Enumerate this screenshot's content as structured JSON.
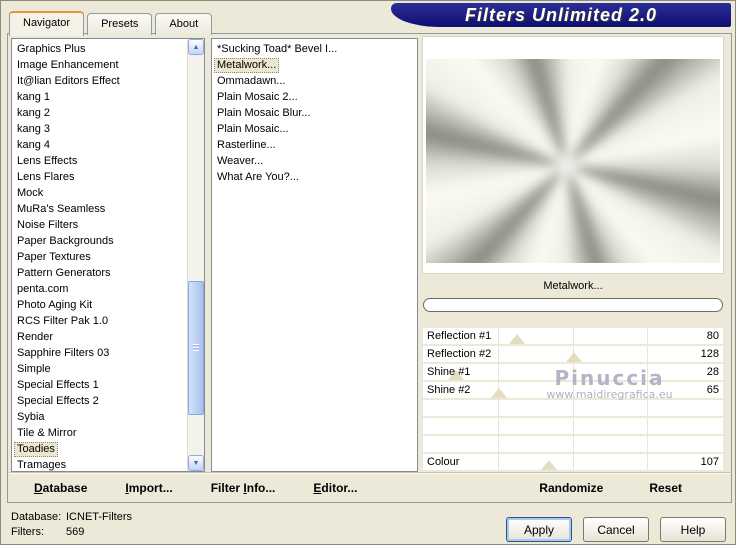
{
  "window": {
    "title": "Filters Unlimited 2.0"
  },
  "tabs": [
    {
      "label": "Navigator",
      "active": true
    },
    {
      "label": "Presets",
      "active": false
    },
    {
      "label": "About",
      "active": false
    }
  ],
  "categories": {
    "selected": "Toadies",
    "items": [
      "Graphics Plus",
      "Image Enhancement",
      "It@lian Editors Effect",
      "kang 1",
      "kang 2",
      "kang 3",
      "kang 4",
      "Lens Effects",
      "Lens Flares",
      "Mock",
      "MuRa's Seamless",
      "Noise Filters",
      "Paper Backgrounds",
      "Paper Textures",
      "Pattern Generators",
      "penta.com",
      "Photo Aging Kit",
      "RCS Filter Pak 1.0",
      "Render",
      "Sapphire Filters 03",
      "Simple",
      "Special Effects 1",
      "Special Effects 2",
      "Sybia",
      "Tile & Mirror",
      "Toadies",
      "Tramages"
    ]
  },
  "filters": {
    "selected": "Metalwork...",
    "items": [
      "*Sucking Toad*  Bevel I...",
      "Metalwork...",
      "Ommadawn...",
      "Plain Mosaic 2...",
      "Plain Mosaic Blur...",
      "Plain Mosaic...",
      "Rasterline...",
      "Weaver...",
      "What Are You?..."
    ]
  },
  "preview": {
    "caption": "Metalwork..."
  },
  "sliders": {
    "max": 255,
    "rows": [
      {
        "label": "Reflection #1",
        "value": 80
      },
      {
        "label": "Reflection #2",
        "value": 128
      },
      {
        "label": "Shine #1",
        "value": 28
      },
      {
        "label": "Shine #2",
        "value": 65
      },
      {
        "label": "",
        "value": null
      },
      {
        "label": "",
        "value": null
      },
      {
        "label": "",
        "value": null
      },
      {
        "label": "Colour",
        "value": 107
      }
    ]
  },
  "watermark": {
    "line1": "Pinuccia",
    "line2": "www.maidiregrafica.eu"
  },
  "menu": [
    {
      "pre": "",
      "key": "D",
      "post": "atabase"
    },
    {
      "pre": "",
      "key": "I",
      "post": "mport..."
    },
    {
      "pre": "Filter ",
      "key": "I",
      "post": "nfo..."
    },
    {
      "pre": "",
      "key": "E",
      "post": "ditor..."
    }
  ],
  "actions": [
    {
      "label": "Randomize"
    },
    {
      "label": "Reset"
    }
  ],
  "status": {
    "rows": [
      {
        "label": "Database:",
        "value": "ICNET-Filters"
      },
      {
        "label": "Filters:",
        "value": "569"
      }
    ]
  },
  "dialog_buttons": [
    {
      "label": "Apply",
      "focused": true
    },
    {
      "label": "Cancel",
      "focused": false
    },
    {
      "label": "Help",
      "focused": false
    }
  ],
  "colors": {
    "dialog_bg": "#ece9d8",
    "banner": "#13157d",
    "selection_bg": "#ebe7d1",
    "slider_handle": "#e3ddc1",
    "watermark": "#b7b3c7",
    "tab_accent": "#e6953e",
    "focus_ring": "#a9c9f1"
  }
}
